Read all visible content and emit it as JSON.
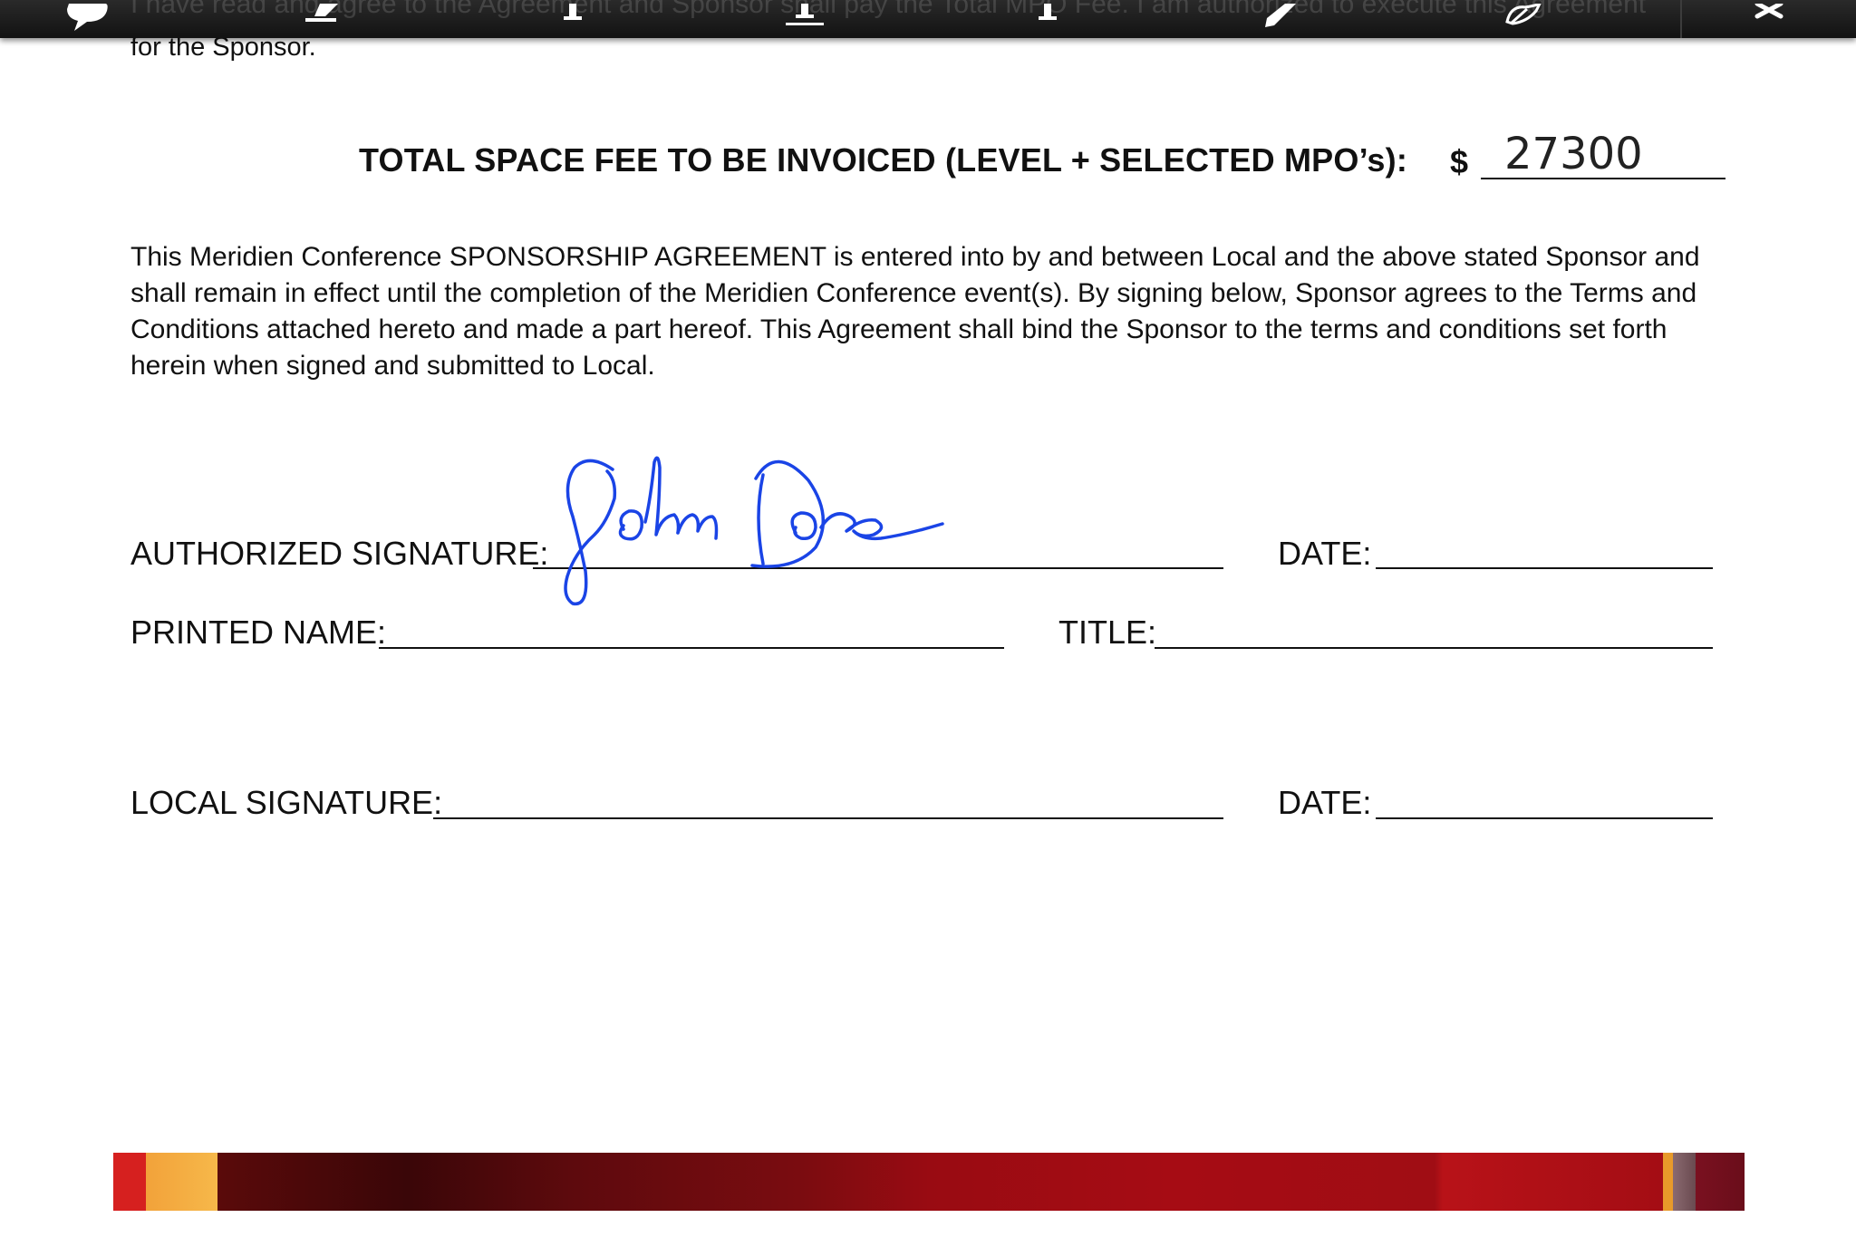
{
  "toolbar": {
    "tools": [
      {
        "name": "comment-icon"
      },
      {
        "name": "highlight-icon"
      },
      {
        "name": "text-icon"
      },
      {
        "name": "underline-text-icon"
      },
      {
        "name": "strikeout-text-icon"
      },
      {
        "name": "draw-pen-icon"
      },
      {
        "name": "signature-icon"
      },
      {
        "name": "close-icon"
      }
    ],
    "bleed_text": "I have read and agree to the Agreement and Sponsor shall pay the Total MPO Fee. I am authorized to execute this Agreement"
  },
  "document": {
    "prev_line": "for the Sponsor.",
    "total_label": "TOTAL SPACE FEE TO BE INVOICED (LEVEL + SELECTED MPO’s):",
    "currency": "$",
    "total_value": "27300",
    "agreement_text": "This Meridien Conference SPONSORSHIP AGREEMENT is entered into by and between Local and the above stated Sponsor and shall remain in effect until the completion of the Meridien Conference event(s). By signing below, Sponsor agrees to the Terms and Conditions attached hereto and made a part hereof. This Agreement shall bind the Sponsor to the terms and conditions set forth herein when signed and submitted to Local.",
    "fields": {
      "authorized_signature": "AUTHORIZED SIGNATURE:",
      "date_1": "DATE:",
      "printed_name": "PRINTED NAME:",
      "title": "TITLE:",
      "local_signature": "LOCAL SIGNATURE:",
      "date_2": "DATE:"
    },
    "signature_value": "John Doe",
    "signature_color": "#1a44e6"
  },
  "colors": {
    "toolbar_bg": "#1a1a1a",
    "banner_primary": "#a00d14",
    "banner_accent": "#f6b84a"
  }
}
